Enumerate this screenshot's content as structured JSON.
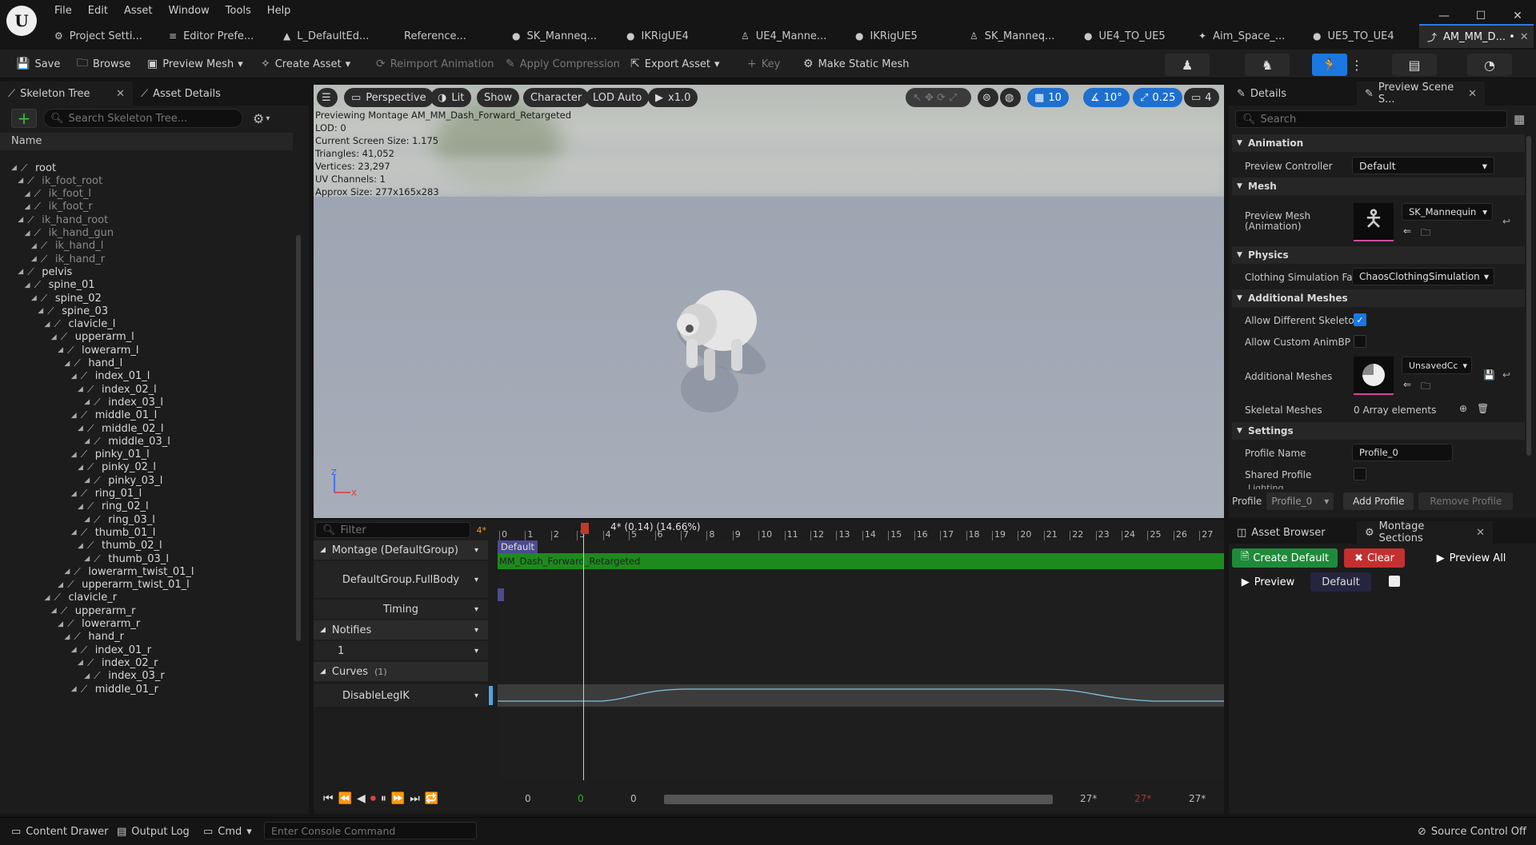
{
  "menu": [
    "File",
    "Edit",
    "Asset",
    "Window",
    "Tools",
    "Help"
  ],
  "tabs": [
    {
      "label": "Project Setti...",
      "icon": "⚙"
    },
    {
      "label": "Editor Prefe...",
      "icon": "≡"
    },
    {
      "label": "L_DefaultEd...",
      "icon": "▲"
    },
    {
      "label": "Reference...",
      "icon": ""
    },
    {
      "label": "SK_Manneq...",
      "icon": "●"
    },
    {
      "label": "IKRigUE4",
      "icon": "●"
    },
    {
      "label": "UE4_Manne...",
      "icon": "♙"
    },
    {
      "label": "IKRigUE5",
      "icon": "●"
    },
    {
      "label": "SK_Manneq...",
      "icon": "♙"
    },
    {
      "label": "UE4_TO_UE5",
      "icon": "●"
    },
    {
      "label": "Aim_Space_...",
      "icon": "✦"
    },
    {
      "label": "UE5_TO_UE4",
      "icon": "●"
    },
    {
      "label": "AM_MM_D... •",
      "icon": "⤴"
    }
  ],
  "toolbar": {
    "save": "Save",
    "browse": "Browse",
    "preview_mesh": "Preview Mesh",
    "create_asset": "Create Asset",
    "reimport": "Reimport Animation",
    "apply_compression": "Apply Compression",
    "export_asset": "Export Asset",
    "key": "Key",
    "make_static_mesh": "Make Static Mesh"
  },
  "left": {
    "tab1": "Skeleton Tree",
    "tab2": "Asset Details",
    "search_placeholder": "Search Skeleton Tree...",
    "col": "Name",
    "bones": [
      {
        "n": "root",
        "d": 0,
        "vg": false
      },
      {
        "n": "ik_foot_root",
        "d": 1,
        "vg": true
      },
      {
        "n": "ik_foot_l",
        "d": 2,
        "vg": true
      },
      {
        "n": "ik_foot_r",
        "d": 2,
        "vg": true
      },
      {
        "n": "ik_hand_root",
        "d": 1,
        "vg": true
      },
      {
        "n": "ik_hand_gun",
        "d": 2,
        "vg": true
      },
      {
        "n": "ik_hand_l",
        "d": 3,
        "vg": true
      },
      {
        "n": "ik_hand_r",
        "d": 3,
        "vg": true
      },
      {
        "n": "pelvis",
        "d": 1,
        "vg": false
      },
      {
        "n": "spine_01",
        "d": 2,
        "vg": false
      },
      {
        "n": "spine_02",
        "d": 3,
        "vg": false
      },
      {
        "n": "spine_03",
        "d": 4,
        "vg": false
      },
      {
        "n": "clavicle_l",
        "d": 5,
        "vg": false
      },
      {
        "n": "upperarm_l",
        "d": 6,
        "vg": false
      },
      {
        "n": "lowerarm_l",
        "d": 7,
        "vg": false
      },
      {
        "n": "hand_l",
        "d": 8,
        "vg": false
      },
      {
        "n": "index_01_l",
        "d": 9,
        "vg": false
      },
      {
        "n": "index_02_l",
        "d": 10,
        "vg": false
      },
      {
        "n": "index_03_l",
        "d": 11,
        "vg": false
      },
      {
        "n": "middle_01_l",
        "d": 9,
        "vg": false
      },
      {
        "n": "middle_02_l",
        "d": 10,
        "vg": false
      },
      {
        "n": "middle_03_l",
        "d": 11,
        "vg": false
      },
      {
        "n": "pinky_01_l",
        "d": 9,
        "vg": false
      },
      {
        "n": "pinky_02_l",
        "d": 10,
        "vg": false
      },
      {
        "n": "pinky_03_l",
        "d": 11,
        "vg": false
      },
      {
        "n": "ring_01_l",
        "d": 9,
        "vg": false
      },
      {
        "n": "ring_02_l",
        "d": 10,
        "vg": false
      },
      {
        "n": "ring_03_l",
        "d": 11,
        "vg": false
      },
      {
        "n": "thumb_01_l",
        "d": 9,
        "vg": false
      },
      {
        "n": "thumb_02_l",
        "d": 10,
        "vg": false
      },
      {
        "n": "thumb_03_l",
        "d": 11,
        "vg": false
      },
      {
        "n": "lowerarm_twist_01_l",
        "d": 8,
        "vg": false
      },
      {
        "n": "upperarm_twist_01_l",
        "d": 7,
        "vg": false
      },
      {
        "n": "clavicle_r",
        "d": 5,
        "vg": false
      },
      {
        "n": "upperarm_r",
        "d": 6,
        "vg": false
      },
      {
        "n": "lowerarm_r",
        "d": 7,
        "vg": false
      },
      {
        "n": "hand_r",
        "d": 8,
        "vg": false
      },
      {
        "n": "index_01_r",
        "d": 9,
        "vg": false
      },
      {
        "n": "index_02_r",
        "d": 10,
        "vg": false
      },
      {
        "n": "index_03_r",
        "d": 11,
        "vg": false
      },
      {
        "n": "middle_01_r",
        "d": 9,
        "vg": false
      }
    ]
  },
  "viewport": {
    "perspective": "Perspective",
    "lit": "Lit",
    "show": "Show",
    "character": "Character",
    "lod": "LOD Auto",
    "speed": "x1.0",
    "grid": "10",
    "angle": "10°",
    "scale": "0.25",
    "cam": "4",
    "info": [
      "Previewing Montage AM_MM_Dash_Forward_Retargeted",
      "LOD: 0",
      "Current Screen Size: 1.175",
      "Triangles: 41,052",
      "Vertices: 23,297",
      "UV Channels: 1",
      "Approx Size: 277x165x283"
    ]
  },
  "timeline": {
    "filter_placeholder": "Filter",
    "count": "4*",
    "playhead": "4* (0.14) (14.66%)",
    "ticks": [
      "0",
      "1",
      "2",
      "3",
      "4",
      "5",
      "6",
      "7",
      "8",
      "9",
      "10",
      "11",
      "12",
      "13",
      "14",
      "15",
      "16",
      "17",
      "18",
      "19",
      "20",
      "21",
      "22",
      "23",
      "24",
      "25",
      "26",
      "27"
    ],
    "montage": "Montage (DefaultGroup)",
    "slot": "DefaultGroup.FullBody",
    "timing": "Timing",
    "notifies": "Notifies",
    "notify_track": "1",
    "curves": "Curves",
    "curves_count": "(1)",
    "curve": "DisableLegIK",
    "section": "Default",
    "segment": "MM_Dash_Forward_Retargeted",
    "t_start": "0",
    "t_green": "0",
    "t_mid": "0",
    "t_end1": "27*",
    "t_red": "27*",
    "t_end2": "27*"
  },
  "details": {
    "tab1": "Details",
    "tab2": "Preview Scene S...",
    "search_placeholder": "Search",
    "sec_animation": "Animation",
    "preview_controller": "Preview Controller",
    "preview_controller_val": "Default",
    "sec_mesh": "Mesh",
    "preview_mesh": "Preview Mesh",
    "preview_mesh_sub": "(Animation)",
    "preview_mesh_val": "SK_Mannequin",
    "sec_physics": "Physics",
    "clothing": "Clothing Simulation Fact",
    "clothing_val": "ChaosClothingSimulation",
    "sec_additional": "Additional Meshes",
    "allow_diff": "Allow Different Skeleton",
    "allow_custom": "Allow Custom AnimBP O",
    "additional_meshes": "Additional Meshes",
    "additional_val": "UnsavedCc",
    "skeletal_meshes": "Skeletal Meshes",
    "array_elems": "0 Array elements",
    "sec_settings": "Settings",
    "profile_name": "Profile Name",
    "profile_name_val": "Profile_0",
    "shared_profile": "Shared Profile",
    "lighting": "Lighting",
    "profile_label": "Profile",
    "profile_val": "Profile_0",
    "add_profile": "Add Profile",
    "remove_profile": "Remove Profile"
  },
  "sections": {
    "tab1": "Asset Browser",
    "tab2": "Montage Sections",
    "create_default": "Create Default",
    "clear": "Clear",
    "preview_all": "Preview All",
    "preview": "Preview",
    "default": "Default"
  },
  "status": {
    "content_drawer": "Content Drawer",
    "output_log": "Output Log",
    "cmd": "Cmd",
    "console_placeholder": "Enter Console Command",
    "source_control": "Source Control Off"
  },
  "colors": {
    "accent": "#1a78e0",
    "track_green": "#1d8a1d",
    "curve": "#7fc3e0",
    "section": "#4b4b8f"
  }
}
